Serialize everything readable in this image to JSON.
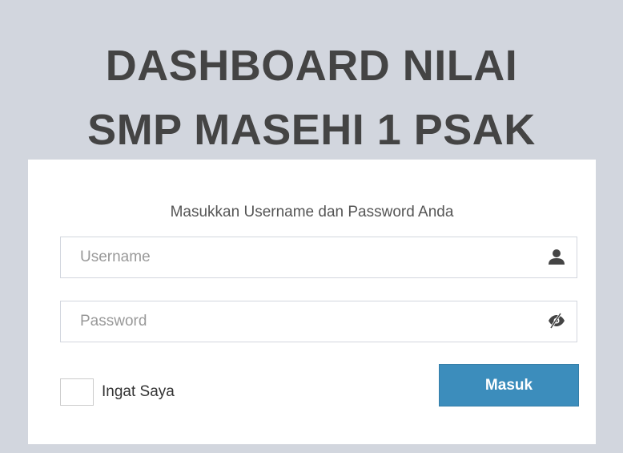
{
  "header": {
    "title_line1": "DASHBOARD NILAI",
    "title_line2": "SMP MASEHI 1 PSAK"
  },
  "login": {
    "message": "Masukkan Username dan Password Anda",
    "username": {
      "placeholder": "Username",
      "value": "",
      "icon": "user-icon"
    },
    "password": {
      "placeholder": "Password",
      "value": "",
      "icon": "eye-slash-icon"
    },
    "remember_label": "Ingat Saya",
    "remember_checked": false,
    "submit_label": "Masuk"
  },
  "colors": {
    "background": "#d2d6de",
    "title": "#444444",
    "primary_button": "#3c8dbc"
  }
}
